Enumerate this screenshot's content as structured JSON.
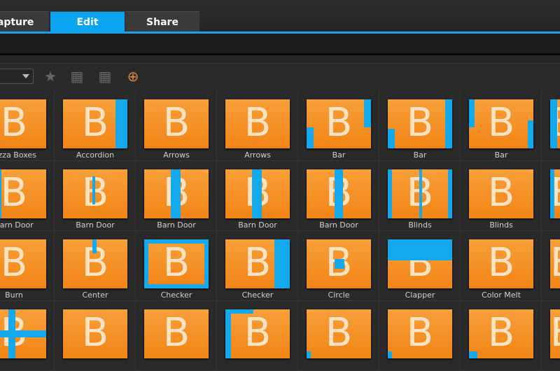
{
  "tabs": [
    {
      "label": "Capture"
    },
    {
      "label": "Edit",
      "active": true
    },
    {
      "label": "Share"
    }
  ],
  "toolbar": {
    "icons": [
      "add-favorite-icon",
      "apply-to-all-icon",
      "apply-random-icon",
      "download-content-icon"
    ]
  },
  "colors": {
    "accent": "#0aa4f0",
    "thumb": "#f28415"
  },
  "thumbnail_letter": "B",
  "rows": [
    [
      "Pizza Boxes",
      "Accordion",
      "Arrows",
      "Arrows",
      "Bar",
      "Bar",
      "Bar",
      ""
    ],
    [
      "Barn Door",
      "Barn Door",
      "Barn Door",
      "Barn Door",
      "Barn Door",
      "Blinds",
      "Blinds",
      ""
    ],
    [
      "Burn",
      "Center",
      "Checker",
      "Checker",
      "Circle",
      "Clapper",
      "Color Melt",
      ""
    ],
    [
      "",
      "",
      "",
      "",
      "",
      "",
      "",
      ""
    ]
  ]
}
